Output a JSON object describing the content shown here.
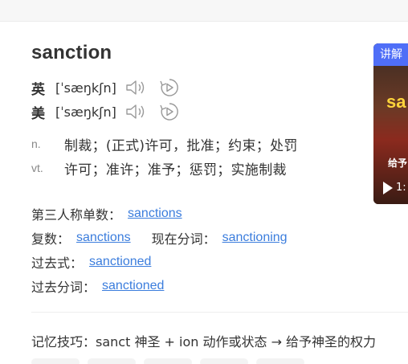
{
  "headword": "sanction",
  "pronunciations": [
    {
      "lang": "英",
      "ipa": "[ˈsæŋkʃn]",
      "speaker_icon": "speaker-icon",
      "replay_icon": "replay-icon"
    },
    {
      "lang": "美",
      "ipa": "[ˈsæŋkʃn]",
      "speaker_icon": "speaker-icon",
      "replay_icon": "replay-icon"
    }
  ],
  "definitions": [
    {
      "pos": "n.",
      "text": "制裁；(正式)许可，批准；约束；处罚"
    },
    {
      "pos": "vt.",
      "text": "许可；准许；准予；惩罚；实施制裁"
    }
  ],
  "word_forms": {
    "third_person": {
      "label": "第三人称单数：",
      "value": "sanctions"
    },
    "plural": {
      "label": "复数：",
      "value": "sanctions"
    },
    "present_participle": {
      "label": "现在分词：",
      "value": "sanctioning"
    },
    "past_tense": {
      "label": "过去式：",
      "value": "sanctioned"
    },
    "past_participle": {
      "label": "过去分词：",
      "value": "sanctioned"
    }
  },
  "memory_tip": "记忆技巧：sanct 神圣 + ion 动作或状态 → 给予神圣的权力",
  "video_card": {
    "badge": "讲解",
    "title": "sa",
    "subtitle": "给予",
    "time": "1:"
  },
  "colors": {
    "link": "#3b7ddd",
    "badge": "#4f6ef7",
    "text": "#333333"
  }
}
